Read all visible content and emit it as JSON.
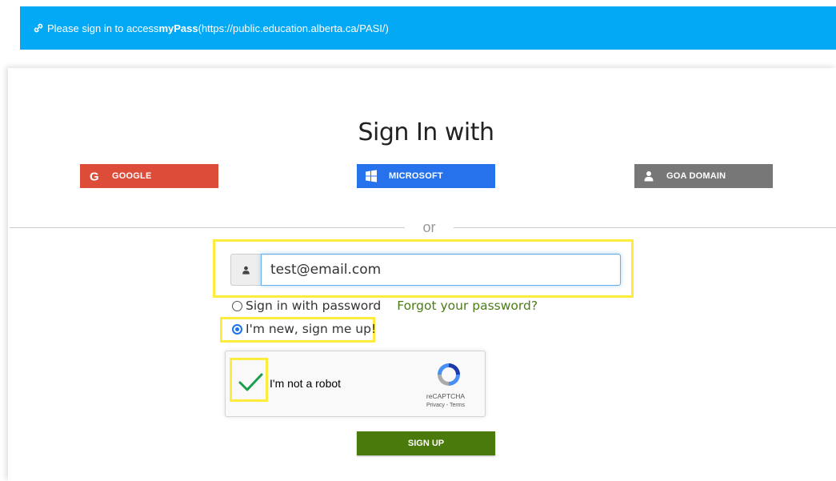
{
  "banner": {
    "icon": "link-icon",
    "prefix": "Please sign in to access ",
    "app_name": "myPass",
    "url": " (https://public.education.alberta.ca/PASI/)"
  },
  "title": "Sign In with",
  "sso": {
    "google": "GOOGLE",
    "microsoft": "MICROSOFT",
    "goa": "GOA DOMAIN"
  },
  "divider_text": "or",
  "email": {
    "icon": "user-icon",
    "value": "test@email.com"
  },
  "options": {
    "password_label": "Sign in with password",
    "forgot_label": "Forgot your password?",
    "new_label": "I'm new, sign me up!",
    "selected": "new"
  },
  "captcha": {
    "label": "I'm not a robot",
    "brand": "reCAPTCHA",
    "terms": "Privacy - Terms",
    "checked": true
  },
  "signup_label": "SIGN UP",
  "colors": {
    "banner": "#03a9f4",
    "google": "#dd4b39",
    "microsoft": "#2672ec",
    "goa": "#777777",
    "signup": "#4a7a0b",
    "highlight": "#ffeb3b"
  }
}
